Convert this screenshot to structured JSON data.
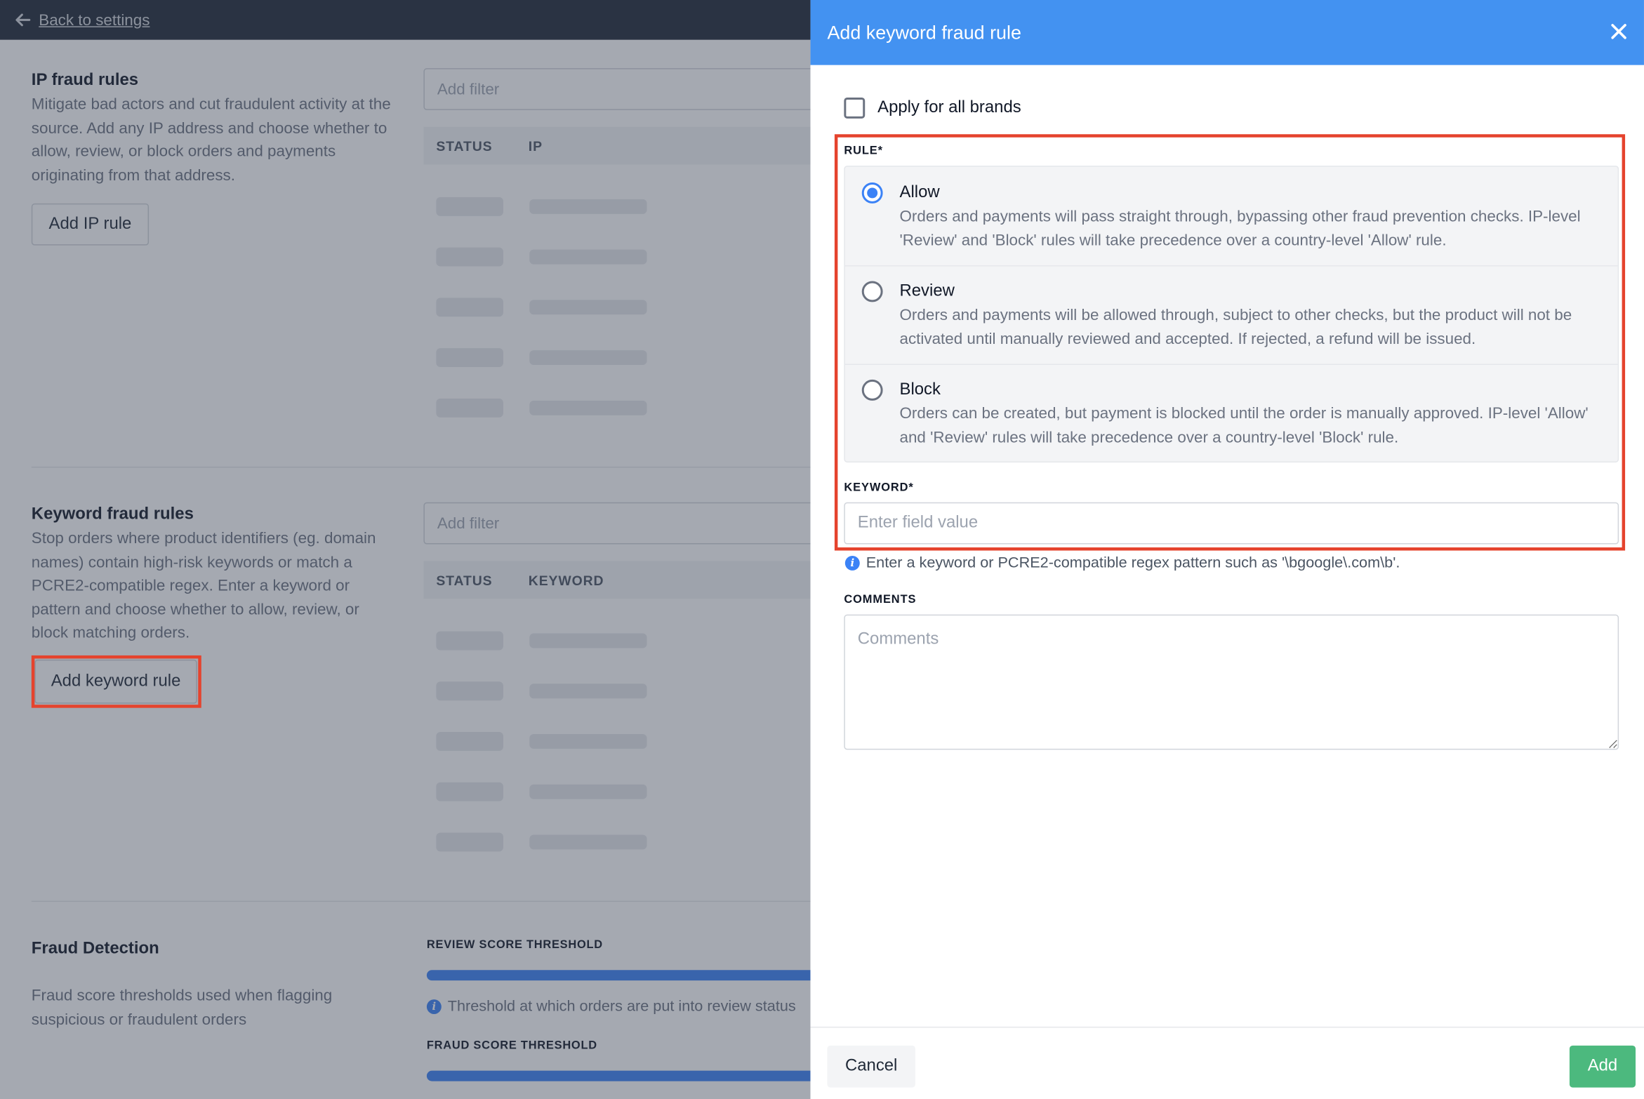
{
  "topbar": {
    "back_label": "Back to settings"
  },
  "ip_section": {
    "title": "IP fraud rules",
    "description": "Mitigate bad actors and cut fraudulent activity at the source. Add any IP address and choose whether to allow, review, or block orders and payments originating from that address.",
    "button": "Add IP rule",
    "filter_placeholder": "Add filter",
    "columns": [
      "STATUS",
      "IP"
    ]
  },
  "keyword_section": {
    "title": "Keyword fraud rules",
    "description": "Stop orders where product identifiers (eg. domain names) contain high-risk keywords or match a PCRE2-compatible regex. Enter a keyword or pattern and choose whether to allow, review, or block matching orders.",
    "button": "Add keyword rule",
    "filter_placeholder": "Add filter",
    "columns": [
      "STATUS",
      "KEYWORD"
    ]
  },
  "fraud_detection": {
    "title": "Fraud Detection",
    "description": "Fraud score thresholds used when flagging suspicious or fraudulent orders",
    "review_label": "REVIEW SCORE THRESHOLD",
    "review_hint": "Threshold at which orders are put into review status",
    "fraud_label": "FRAUD SCORE THRESHOLD"
  },
  "drawer": {
    "title": "Add keyword fraud rule",
    "apply_all_label": "Apply for all brands",
    "apply_all_checked": false,
    "rule_label": "RULE*",
    "rules": [
      {
        "title": "Allow",
        "desc": "Orders and payments will pass straight through, bypassing other fraud prevention checks. IP-level 'Review' and 'Block' rules will take precedence over a country-level 'Allow' rule.",
        "checked": true
      },
      {
        "title": "Review",
        "desc": "Orders and payments will be allowed through, subject to other checks, but the product will not be activated until manually reviewed and accepted. If rejected, a refund will be issued.",
        "checked": false
      },
      {
        "title": "Block",
        "desc": "Orders can be created, but payment is blocked until the order is manually approved. IP-level 'Allow' and 'Review' rules will take precedence over a country-level 'Block' rule.",
        "checked": false
      }
    ],
    "keyword_label": "KEYWORD*",
    "keyword_placeholder": "Enter field value",
    "keyword_hint": "Enter a keyword or PCRE2-compatible regex pattern such as '\\bgoogle\\.com\\b'.",
    "comments_label": "COMMENTS",
    "comments_placeholder": "Comments",
    "cancel_label": "Cancel",
    "add_label": "Add"
  },
  "icons": {
    "back": "arrow-left-icon",
    "close": "close-icon",
    "info": "info-icon"
  },
  "colors": {
    "header": "#4392f1",
    "accent": "#3b82f6",
    "add_button": "#4cb97e",
    "highlight": "#e5432d"
  }
}
